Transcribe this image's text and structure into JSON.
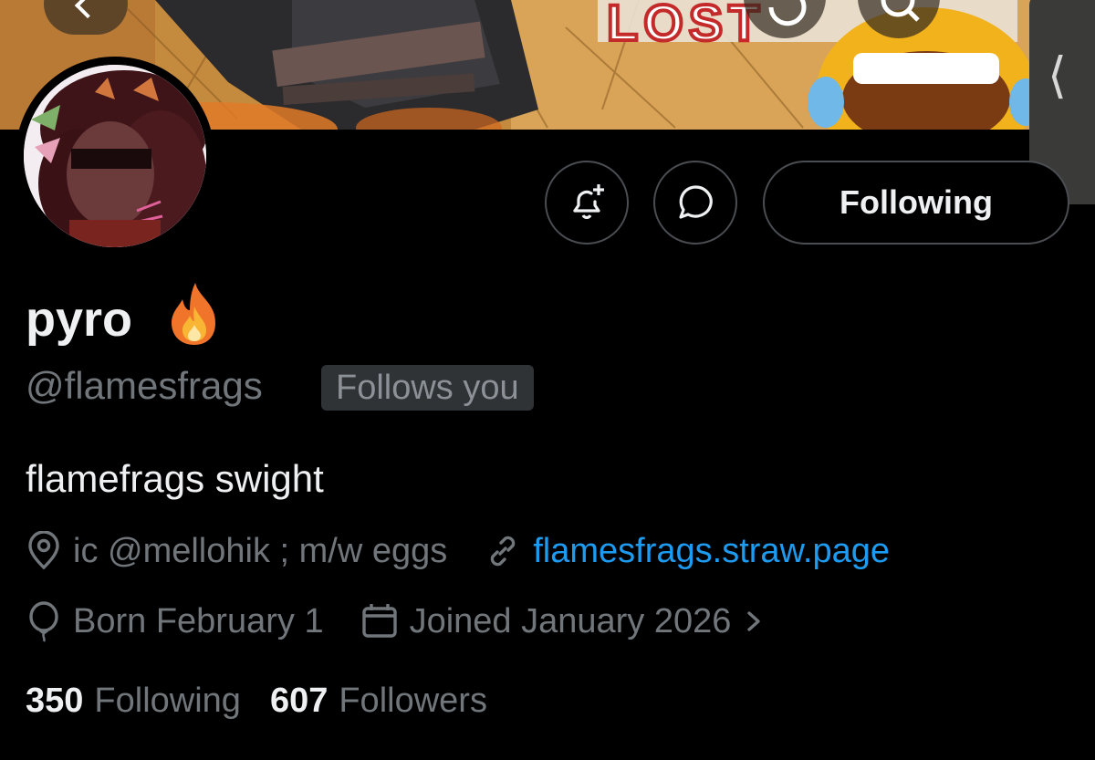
{
  "banner": {
    "sign_text": "LOST"
  },
  "profile": {
    "display_name": "pyro",
    "name_emoji": "fire-emoji",
    "handle": "@flamesfrags",
    "follows_you_label": "Follows you",
    "bio": "flamefrags swight",
    "location": "ic @mellohik ; m/w eggs",
    "website": "flamesfrags.straw.page",
    "birthday": "Born February 1",
    "joined": "Joined January 2026",
    "following_count": "350",
    "following_label": "Following",
    "followers_count": "607",
    "followers_label": "Followers"
  },
  "actions": {
    "following_button_label": "Following"
  },
  "icons": {
    "back": "chevron-left-icon",
    "refresh": "refresh-icon",
    "search": "search-icon",
    "drawer": "chevron-left-icon",
    "notify": "bell-plus-icon",
    "message": "chat-bubble-icon",
    "location": "location-pin-icon",
    "link": "link-icon",
    "birthday": "balloon-icon",
    "joined": "calendar-icon",
    "joined_more": "chevron-right-icon"
  },
  "colors": {
    "background": "#000000",
    "primary_text": "#eef0f2",
    "secondary_text": "#71767b",
    "link": "#1d9bf0",
    "border": "#4a4e52",
    "badge_bg": "#2f3336"
  }
}
